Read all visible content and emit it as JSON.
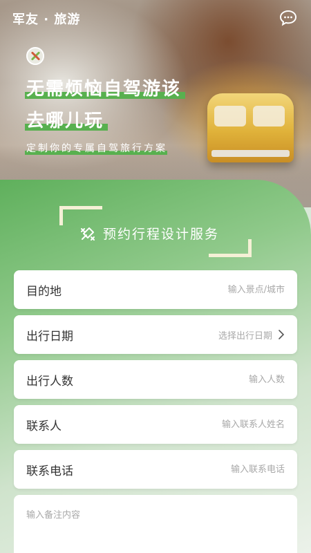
{
  "header": {
    "brand": "军友 · 旅游",
    "chat_icon": "chat-bubble-icon"
  },
  "hero": {
    "logo_icon": "brand-x-logo",
    "headline_line1": "无需烦恼自驾游该",
    "headline_line2": "去哪儿玩",
    "subtitle": "定制你的专属自驾旅行方案",
    "accent_color": "#58b04f"
  },
  "service": {
    "title": "预约行程设计服务",
    "icon": "route-pencil-icon"
  },
  "form": {
    "destination": {
      "label": "目的地",
      "placeholder": "输入景点/城市"
    },
    "date": {
      "label": "出行日期",
      "placeholder": "选择出行日期",
      "icon": "chevron-right-icon"
    },
    "people": {
      "label": "出行人数",
      "placeholder": "输入人数"
    },
    "contact": {
      "label": "联系人",
      "placeholder": "输入联系人姓名"
    },
    "phone": {
      "label": "联系电话",
      "placeholder": "输入联系电话"
    },
    "notes": {
      "placeholder": "输入备注内容"
    }
  }
}
